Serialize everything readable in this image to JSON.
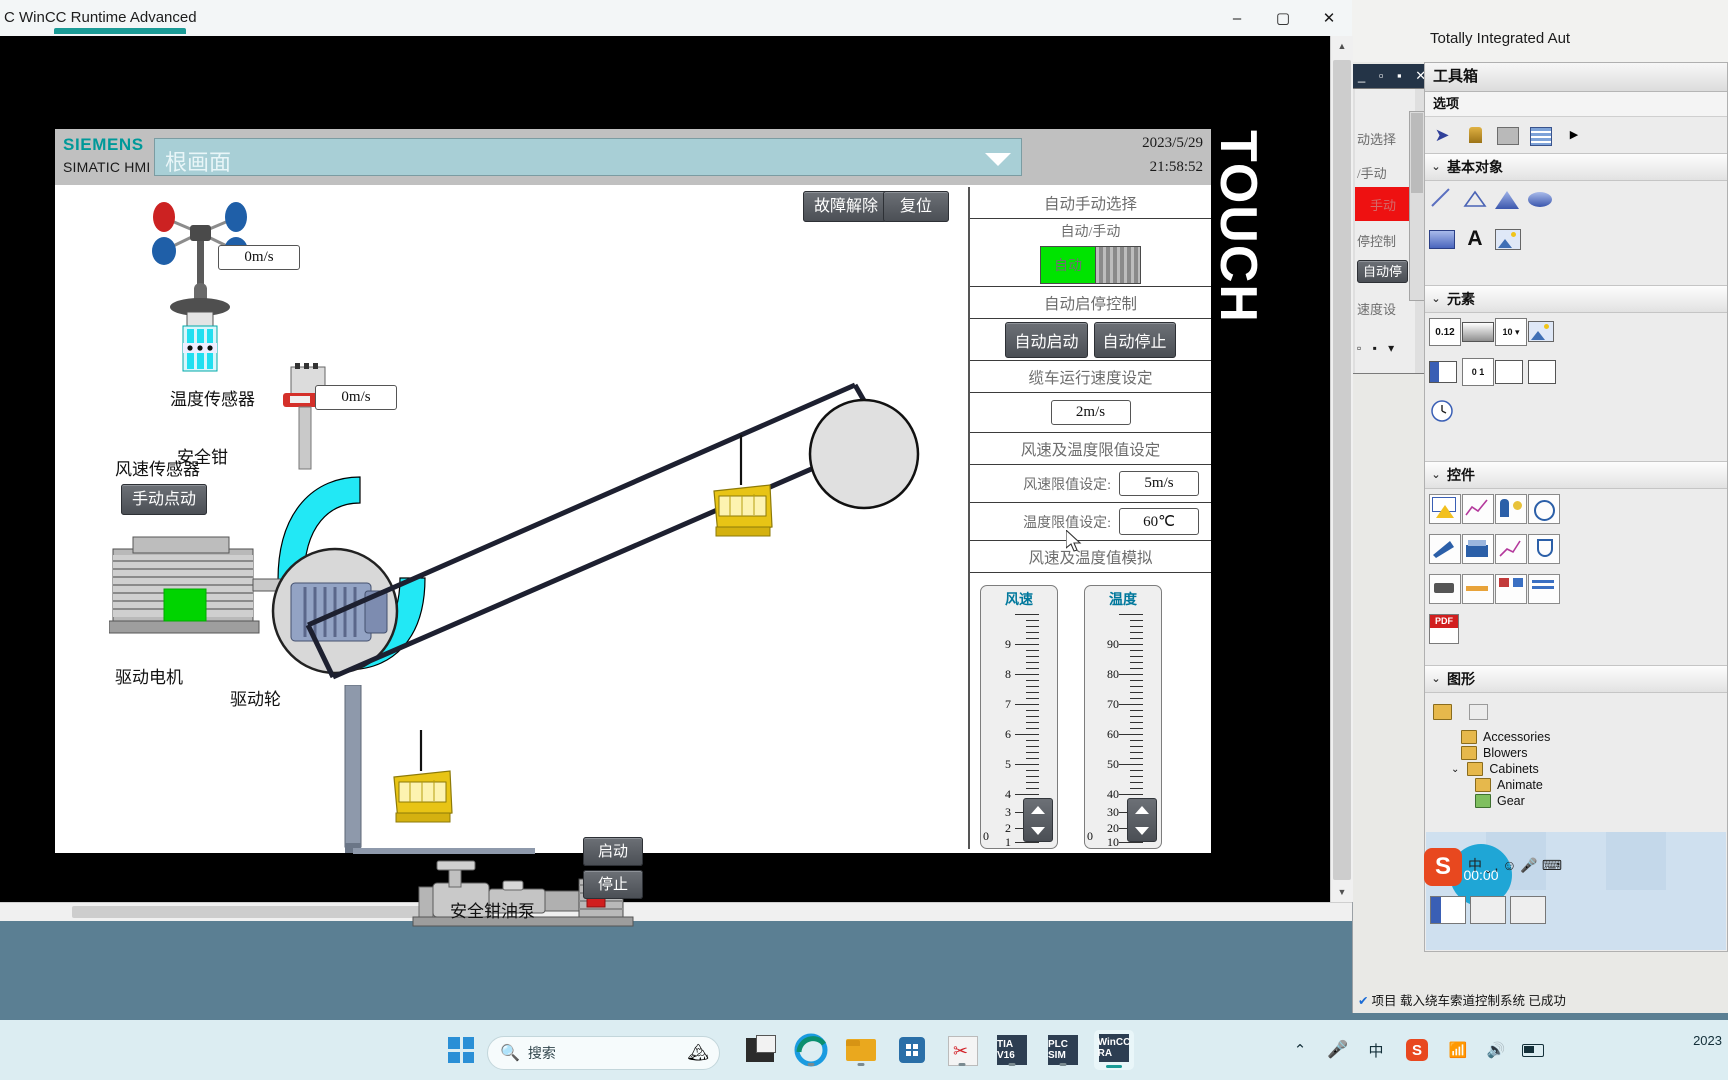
{
  "window": {
    "title": "C WinCC Runtime Advanced",
    "minimize": "–",
    "maximize": "▢",
    "close": "✕"
  },
  "tia": {
    "header_right": "Totally Integrated Aut",
    "toolbox_title": "工具箱",
    "options_label": "选项",
    "sections": {
      "basic_objects": "基本对象",
      "elements": "元素",
      "controls": "控件",
      "graphics": "图形"
    },
    "graphics_items": [
      {
        "label": "Accessories",
        "color": "yellow"
      },
      {
        "label": "Blowers",
        "color": "yellow"
      },
      {
        "label": "Cabinets",
        "color": "yellow"
      },
      {
        "label": "Animate",
        "color": "yellow"
      },
      {
        "label": "Gear",
        "color": "green"
      }
    ],
    "element_icons": [
      "0.12",
      "gradient-bar",
      "dropdown-10",
      "image-element"
    ],
    "status_message": "项目 载入绕车索道控制系统 已成功",
    "mini_window_buttons": "_ ▫ ▪ ✕",
    "side_labels": [
      "动选择",
      "/手动",
      "手动",
      "停控制",
      "自动停",
      "速度设"
    ],
    "clock_widget": "00:00",
    "ime_logo": "S"
  },
  "hmi": {
    "brand": "SIEMENS",
    "subbrand": "SIMATIC HMI",
    "screen_name": "根画面",
    "date": "2023/5/29",
    "time": "21:58:52",
    "touch_text": "TOUCH",
    "toolbar_buttons": [
      {
        "label": "故障解除",
        "name": "fault-clear-button"
      },
      {
        "label": "复位",
        "name": "reset-button"
      }
    ],
    "diagram_labels": {
      "wind_sensor": "风速传感器",
      "temp_sensor": "温度传感器",
      "safety_gear": "安全钳",
      "drive_motor": "驱动电机",
      "drive_wheel": "驱动轮",
      "oil_pump": "安全钳油泵"
    },
    "diagram_values": {
      "wind_speed": "0m/s",
      "temperature": "0m/s"
    },
    "diagram_buttons": {
      "manual_jog": "手动点动",
      "pump_start": "启动",
      "pump_stop": "停止"
    },
    "panel": {
      "auto_manual_header": "自动手动选择",
      "auto_manual_label": "自动/手动",
      "toggle_on_text": "自动",
      "auto_startstop_header": "自动启停控制",
      "auto_start": "自动启动",
      "auto_stop": "自动停止",
      "speed_header": "缆车运行速度设定",
      "speed_value": "2m/s",
      "limits_header": "风速及温度限值设定",
      "wind_limit_label": "风速限值设定:",
      "wind_limit_value": "5m/s",
      "temp_limit_label": "温度限值设定:",
      "temp_limit_value": "60℃",
      "simulation_header": "风速及温度值模拟"
    },
    "gauges": [
      {
        "name": "wind-speed-gauge",
        "title": "风速",
        "ticks": [
          "9",
          "8",
          "7",
          "6",
          "5",
          "4",
          "3",
          "2",
          "1",
          "0"
        ],
        "readout": "0",
        "min": 0,
        "max": 10
      },
      {
        "name": "temperature-gauge",
        "title": "温度",
        "ticks": [
          "90",
          "80",
          "70",
          "60",
          "50",
          "40",
          "30",
          "20",
          "10",
          "0"
        ],
        "readout": "0",
        "min": 0,
        "max": 100
      }
    ]
  },
  "taskbar": {
    "search_placeholder": "搜索",
    "apps": [
      {
        "name": "start-button",
        "label": "⊞"
      },
      {
        "name": "taskview-button",
        "label": "▣"
      },
      {
        "name": "edge-button",
        "label": "e"
      },
      {
        "name": "explorer-button",
        "label": "📁"
      },
      {
        "name": "store-button",
        "label": "▦"
      },
      {
        "name": "snip-button",
        "label": "✂"
      },
      {
        "name": "tia-v16-button",
        "label": "TIA V16"
      },
      {
        "name": "plcsim-button",
        "label": "PLC SIM"
      },
      {
        "name": "wincc-rt-button",
        "label": "WinCC RA"
      }
    ],
    "tray": [
      "^",
      "mic-icon",
      "ime-icon",
      "sogou-icon",
      "wifi-icon",
      "volume-icon",
      "battery-icon"
    ],
    "clock": "2023"
  },
  "colors": {
    "accent_teal": "#009999",
    "toggle_green": "#00e400",
    "manual_red": "#ee1111",
    "panel_grey": "#c0c0c0",
    "title_blue": "#00789c",
    "cable": "#1d2030"
  }
}
